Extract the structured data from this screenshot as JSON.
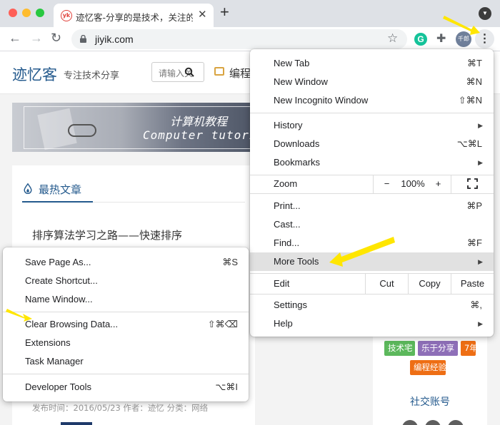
{
  "browser": {
    "tab_title": "迹忆客-分享的是技术，关注的是",
    "url": "jiyik.com",
    "avatar_text": "千郎",
    "extension_g": "G"
  },
  "site": {
    "title": "迹忆客",
    "tagline": "专注技术分享",
    "search_placeholder": "请输入关",
    "nav_label": "编程",
    "banner_cn": "计算机教程",
    "banner_en": "Computer tutorial",
    "hot_label": "最热文章",
    "article_title": "排序算法学习之路——快速排序",
    "article_meta": "发布时间：2016/05/23 作者：迹忆 分类：网络",
    "tags": [
      {
        "label": "技术宅",
        "color": "#5cb85c"
      },
      {
        "label": "乐于分享",
        "color": "#8e6fb8"
      },
      {
        "label": "7年",
        "color": "#ee6e14"
      },
      {
        "label": "编程经验",
        "color": "#ee6e14"
      }
    ],
    "social_title": "社交账号"
  },
  "main_menu": {
    "new_tab": {
      "label": "New Tab",
      "shortcut": "⌘T"
    },
    "new_window": {
      "label": "New Window",
      "shortcut": "⌘N"
    },
    "new_incognito": {
      "label": "New Incognito Window",
      "shortcut": "⇧⌘N"
    },
    "history": {
      "label": "History"
    },
    "downloads": {
      "label": "Downloads",
      "shortcut": "⌥⌘L"
    },
    "bookmarks": {
      "label": "Bookmarks"
    },
    "zoom": {
      "label": "Zoom",
      "minus": "−",
      "level": "100%",
      "plus": "+"
    },
    "print": {
      "label": "Print...",
      "shortcut": "⌘P"
    },
    "cast": {
      "label": "Cast..."
    },
    "find": {
      "label": "Find...",
      "shortcut": "⌘F"
    },
    "more_tools": {
      "label": "More Tools"
    },
    "edit": {
      "label": "Edit",
      "cut": "Cut",
      "copy": "Copy",
      "paste": "Paste"
    },
    "settings": {
      "label": "Settings",
      "shortcut": "⌘,"
    },
    "help": {
      "label": "Help"
    }
  },
  "sub_menu": {
    "save_page": {
      "label": "Save Page As...",
      "shortcut": "⌘S"
    },
    "create_shortcut": {
      "label": "Create Shortcut..."
    },
    "name_window": {
      "label": "Name Window..."
    },
    "clear_data": {
      "label": "Clear Browsing Data...",
      "shortcut": "⇧⌘⌫"
    },
    "extensions": {
      "label": "Extensions"
    },
    "task_manager": {
      "label": "Task Manager"
    },
    "developer_tools": {
      "label": "Developer Tools",
      "shortcut": "⌥⌘I"
    }
  },
  "colors": {
    "annotation_arrow": "#ffe600",
    "menu_highlight": "#e1e1e1",
    "site_accent": "#245a8d"
  }
}
